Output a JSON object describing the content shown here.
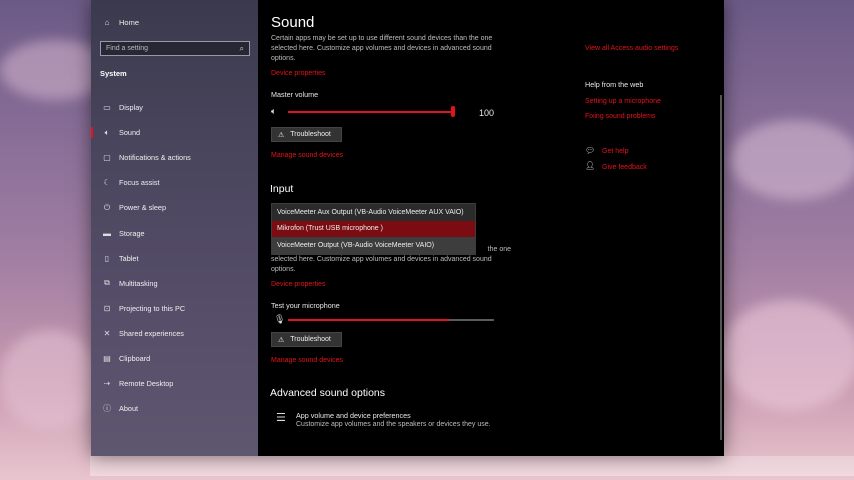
{
  "sidebar": {
    "home_label": "Home",
    "search_placeholder": "Find a setting",
    "section_title": "System",
    "items": [
      {
        "label": "Display",
        "icon": "monitor-icon"
      },
      {
        "label": "Sound",
        "icon": "speaker-icon",
        "active": true
      },
      {
        "label": "Notifications & actions",
        "icon": "notification-icon"
      },
      {
        "label": "Focus assist",
        "icon": "moon-icon"
      },
      {
        "label": "Power & sleep",
        "icon": "power-icon"
      },
      {
        "label": "Storage",
        "icon": "storage-icon"
      },
      {
        "label": "Tablet",
        "icon": "tablet-icon"
      },
      {
        "label": "Multitasking",
        "icon": "multitasking-icon"
      },
      {
        "label": "Projecting to this PC",
        "icon": "projecting-icon"
      },
      {
        "label": "Shared experiences",
        "icon": "shared-icon"
      },
      {
        "label": "Clipboard",
        "icon": "clipboard-icon"
      },
      {
        "label": "Remote Desktop",
        "icon": "remote-desktop-icon"
      },
      {
        "label": "About",
        "icon": "info-icon"
      }
    ]
  },
  "main": {
    "title": "Sound",
    "output": {
      "desc_line1": "Certain apps may be set up to use different sound devices than the one",
      "desc_line2": "selected here. Customize app volumes and devices in advanced sound",
      "desc_line3": "options.",
      "device_properties": "Device properties",
      "master_volume_label": "Master volume",
      "volume_value": "100",
      "volume_level": 1.0,
      "troubleshoot": "Troubleshoot",
      "manage_devices": "Manage sound devices"
    },
    "input": {
      "heading": "Input",
      "options": [
        "VoiceMeeter Aux Output (VB-Audio VoiceMeeter AUX VAIO)",
        "Mikrofon (Trust USB microphone )",
        "VoiceMeeter Output (VB-Audio VoiceMeeter VAIO)"
      ],
      "selected_index": 1,
      "desc_line1": "the one",
      "desc_line2": "selected here. Customize app volumes and devices in advanced sound",
      "desc_line3": "options.",
      "device_properties": "Device properties",
      "test_mic_label": "Test your microphone",
      "mic_level": 0.78,
      "troubleshoot": "Troubleshoot",
      "manage_devices": "Manage sound devices"
    },
    "advanced": {
      "heading": "Advanced sound options",
      "app_volume_title": "App volume and device preferences",
      "app_volume_desc": "Customize app volumes and the speakers or devices they use."
    }
  },
  "right": {
    "view_all_audio": "View all Access audio settings",
    "help_heading": "Help from the web",
    "help_links": [
      "Setting up a microphone",
      "Fixing sound problems"
    ],
    "get_help": "Get help",
    "give_feedback": "Give feedback"
  },
  "colors": {
    "accent": "#e1141b",
    "window_bg": "#000000"
  }
}
